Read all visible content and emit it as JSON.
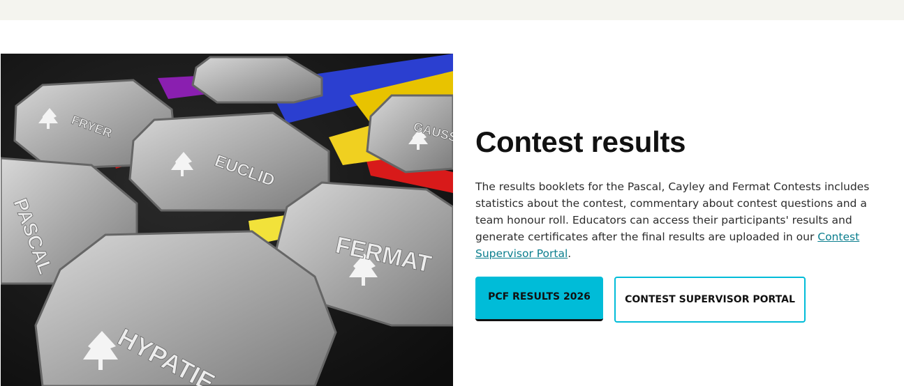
{
  "section": {
    "title": "Contest results",
    "description_before_link": "The results booklets for the Pascal, Cayley and Fermat Contests includes statistics about the contest, commentary about contest questions and a team honour roll. Educators can access their participants' results and generate certificates after the final results are uploaded in our ",
    "description_link": "Contest Supervisor Portal",
    "description_after_link": "."
  },
  "buttons": {
    "primary_label": "PCF RESULTS 2026",
    "secondary_label": "CONTEST SUPERVISOR PORTAL"
  },
  "image": {
    "alt": "Medals",
    "medal_texts": [
      "FRYER",
      "EUCLID",
      "PASCAL",
      "FERMAT",
      "HYPATIE",
      "GAUSS"
    ]
  },
  "colors": {
    "accent": "#00bcd8",
    "link": "#0b7e8e",
    "topbar": "#f4f4ef"
  }
}
